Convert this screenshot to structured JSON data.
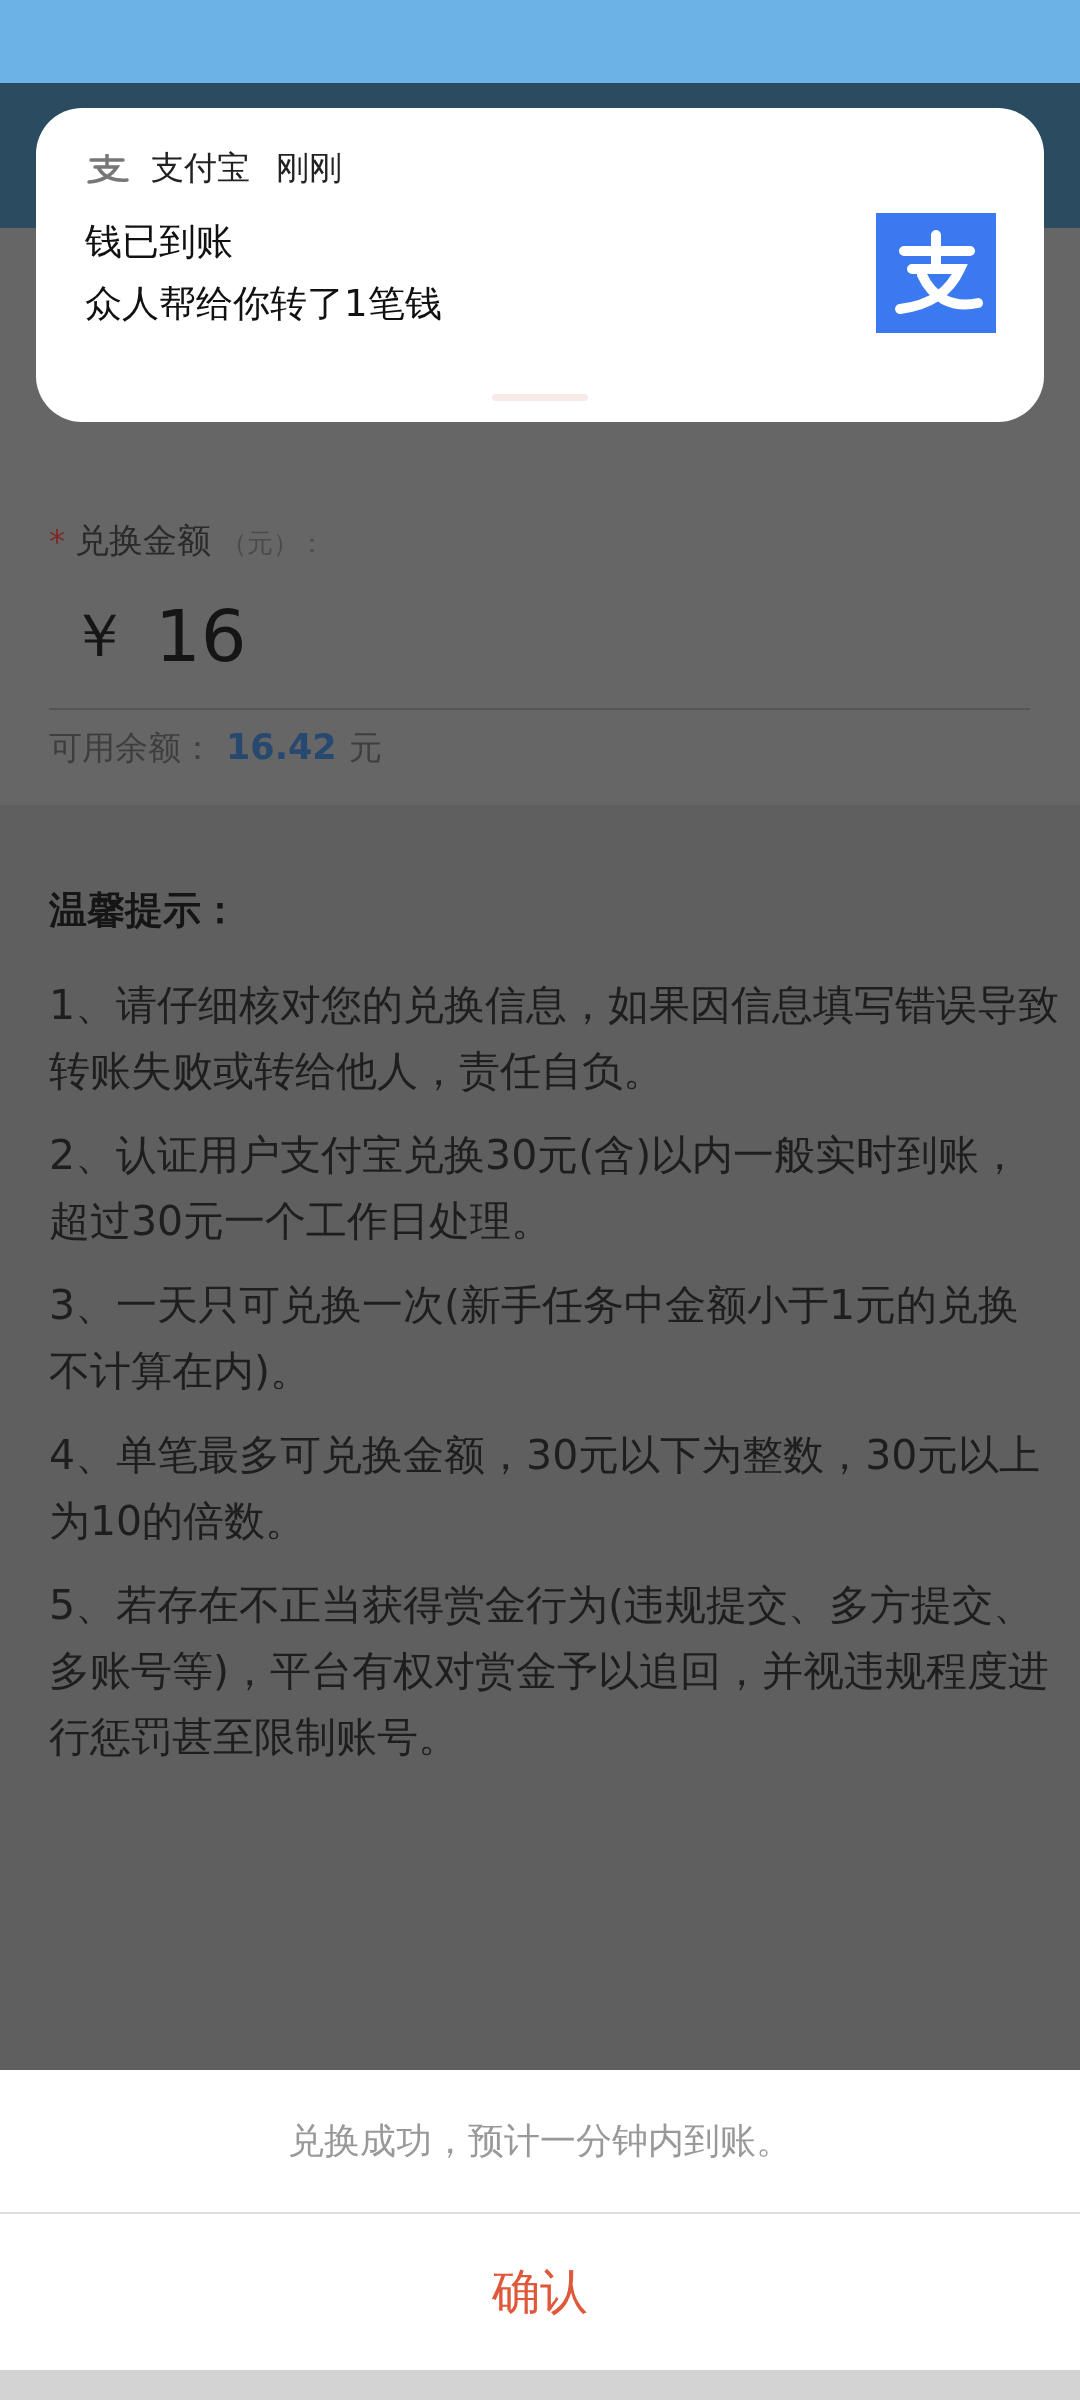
{
  "notification": {
    "app_name": "支付宝",
    "time": "刚刚",
    "title": "钱已到账",
    "message": "众人帮给你转了1笔钱"
  },
  "form": {
    "required_mark": "*",
    "label": "兑换金额",
    "unit_hint": "（元）：",
    "currency": "￥",
    "amount": "16",
    "balance_label": "可用余额：",
    "balance_value": "16.42",
    "balance_unit": "元"
  },
  "tips": {
    "title": "温馨提示：",
    "items": [
      "1、请仔细核对您的兑换信息，如果因信息填写错误导致转账失败或转给他人，责任自负。",
      "2、认证用户支付宝兑换30元(含)以内一般实时到账，超过30元一个工作日处理。",
      "3、一天只可兑换一次(新手任务中金额小于1元的兑换不计算在内)。",
      "4、单笔最多可兑换金额，30元以下为整数，30元以上为10的倍数。",
      "5、若存在不正当获得赏金行为(违规提交、多方提交、多账号等)，平台有权对赏金予以追回，并视违规程度进行惩罚甚至限制账号。"
    ]
  },
  "dialog": {
    "message": "兑换成功，预计一分钟内到账。",
    "buttons": [
      {
        "label": "确认",
        "kind": "primary"
      }
    ]
  }
}
